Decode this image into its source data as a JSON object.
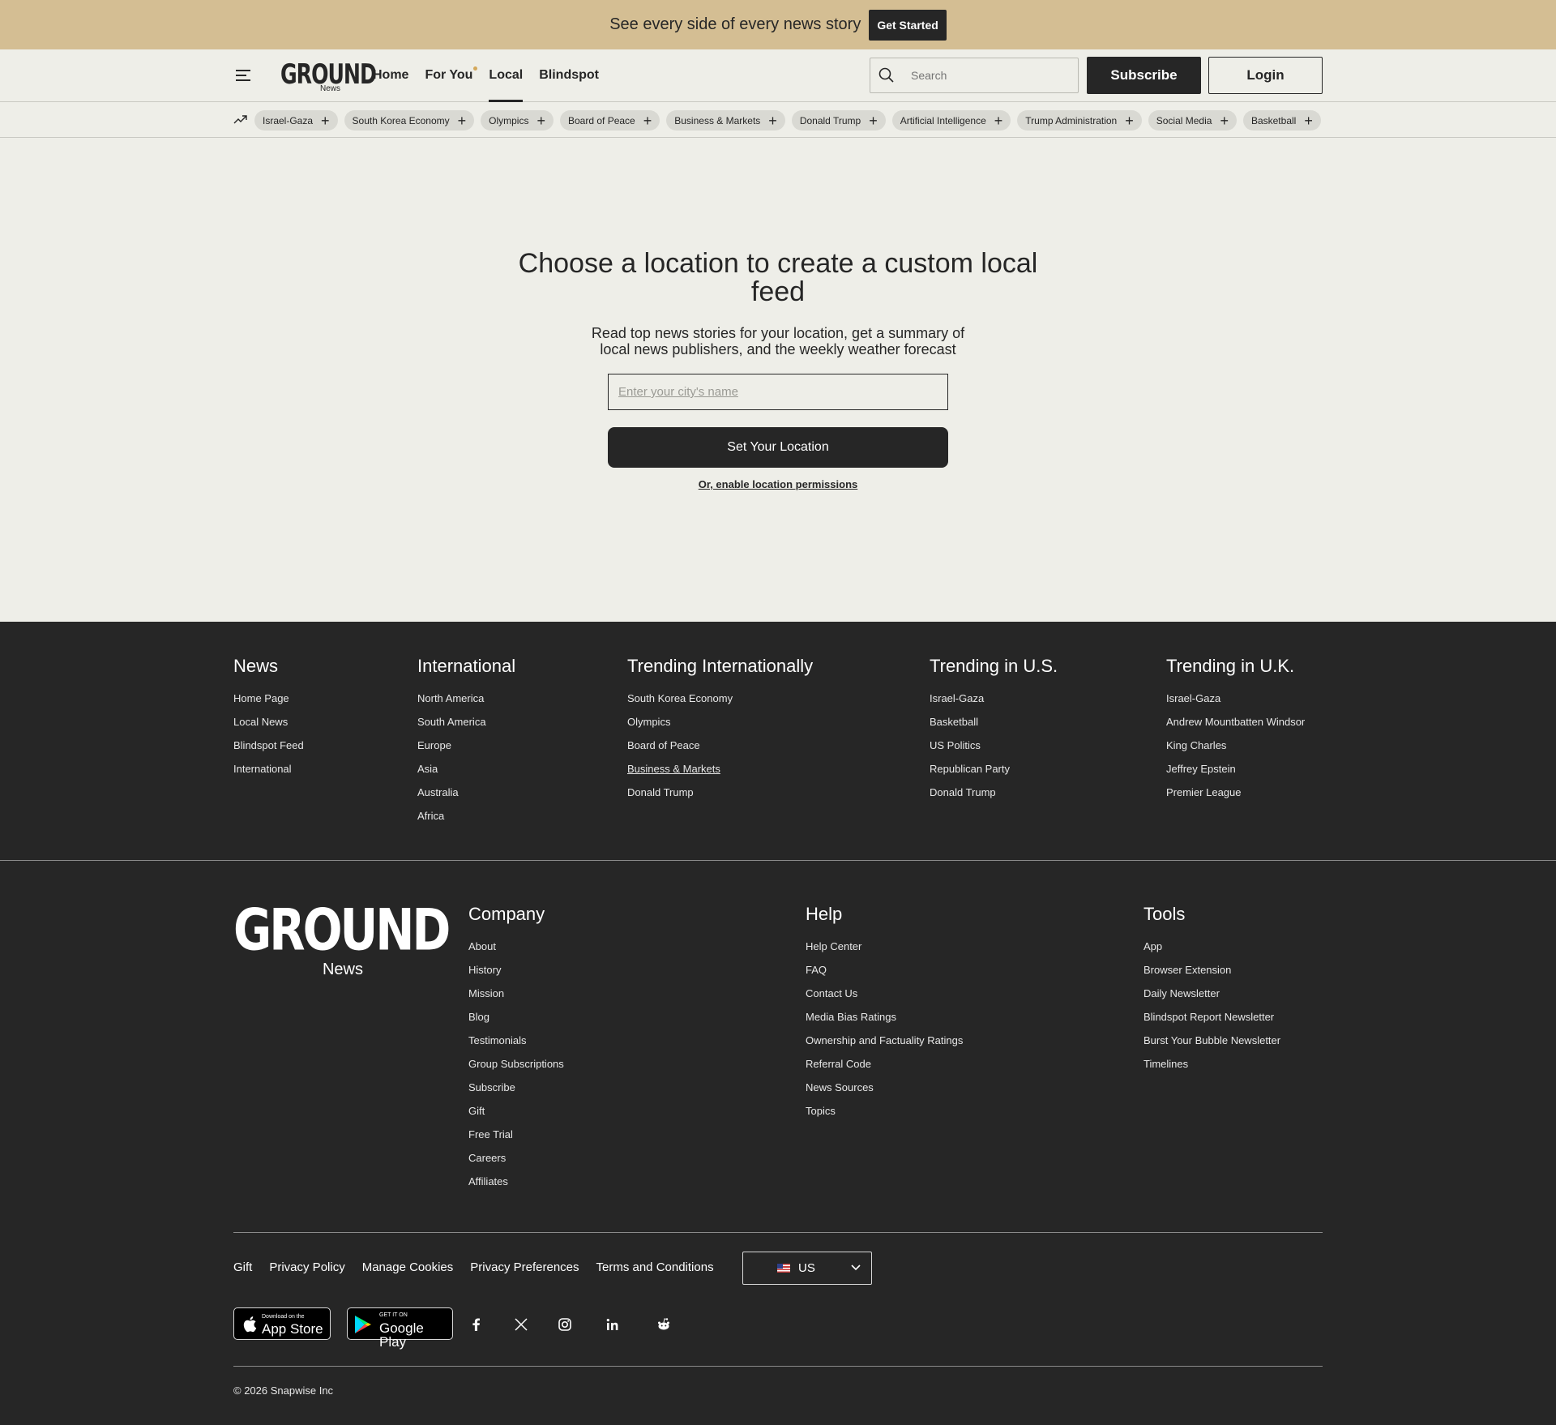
{
  "promo": {
    "text": "See every side of every news story",
    "button": "Get Started"
  },
  "header": {
    "logo": "GROUND",
    "logo_sub": "News",
    "nav": [
      {
        "label": "Home"
      },
      {
        "label": "For You"
      },
      {
        "label": "Local"
      },
      {
        "label": "Blindspot"
      }
    ],
    "search_placeholder": "Search",
    "subscribe": "Subscribe",
    "login": "Login"
  },
  "topics": [
    "Israel-Gaza",
    "South Korea Economy",
    "Olympics",
    "Board of Peace",
    "Business & Markets",
    "Donald Trump",
    "Artificial Intelligence",
    "Trump Administration",
    "Social Media",
    "Basketball"
  ],
  "main": {
    "title": "Choose a location to create a custom local feed",
    "subtitle": "Read top news stories for your location, get a summary of local news publishers, and the weekly weather forecast",
    "city_placeholder": "Enter your city's name",
    "set_button": "Set Your Location",
    "enable_link": "Or, enable location permissions"
  },
  "footer_top": {
    "news": {
      "title": "News",
      "items": [
        "Home Page",
        "Local News",
        "Blindspot Feed",
        "International"
      ]
    },
    "international": {
      "title": "International",
      "items": [
        "North America",
        "South America",
        "Europe",
        "Asia",
        "Australia",
        "Africa"
      ]
    },
    "trending_intl": {
      "title": "Trending Internationally",
      "items": [
        "South Korea Economy",
        "Olympics",
        "Board of Peace",
        "Business & Markets",
        "Donald Trump"
      ]
    },
    "trending_us": {
      "title": "Trending in U.S.",
      "items": [
        "Israel-Gaza",
        "Basketball",
        "US Politics",
        "Republican Party",
        "Donald Trump"
      ]
    },
    "trending_uk": {
      "title": "Trending in U.K.",
      "items": [
        "Israel-Gaza",
        "Andrew Mountbatten Windsor",
        "King Charles",
        "Jeffrey Epstein",
        "Premier League"
      ]
    }
  },
  "footer_bottom": {
    "logo": "GROUND",
    "logo_sub": "News",
    "company": {
      "title": "Company",
      "items": [
        "About",
        "History",
        "Mission",
        "Blog",
        "Testimonials",
        "Group Subscriptions",
        "Subscribe",
        "Gift",
        "Free Trial",
        "Careers",
        "Affiliates"
      ]
    },
    "help": {
      "title": "Help",
      "items": [
        "Help Center",
        "FAQ",
        "Contact Us",
        "Media Bias Ratings",
        "Ownership and Factuality Ratings",
        "Referral Code",
        "News Sources",
        "Topics"
      ]
    },
    "tools": {
      "title": "Tools",
      "items": [
        "App",
        "Browser Extension",
        "Daily Newsletter",
        "Blindspot Report Newsletter",
        "Burst Your Bubble Newsletter",
        "Timelines"
      ]
    },
    "legal": [
      "Gift",
      "Privacy Policy",
      "Manage Cookies",
      "Privacy Preferences",
      "Terms and Conditions"
    ],
    "region": "US",
    "appstore_small": "Download on the",
    "appstore_big": "App Store",
    "googleplay_small": "GET IT ON",
    "googleplay_big": "Google Play",
    "copyright": "© 2026 Snapwise Inc"
  }
}
